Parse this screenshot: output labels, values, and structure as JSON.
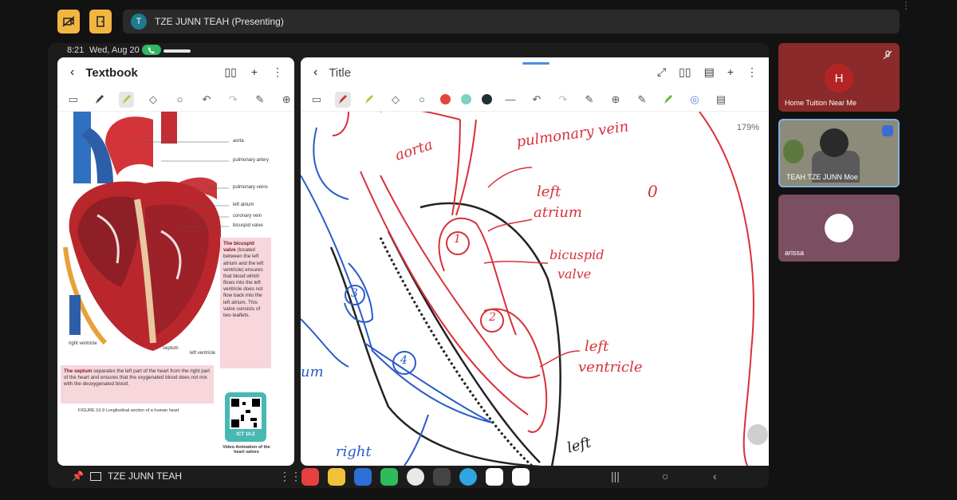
{
  "meeting": {
    "presenter_label": "TZE JUNN TEAH (Presenting)",
    "presenter_initial": "T",
    "bottom_presenter_name": "TZE JUNN TEAH"
  },
  "tablet": {
    "status_time": "8:21",
    "status_date": "Wed, Aug 20"
  },
  "left_panel": {
    "title": "Textbook",
    "heart_labels": [
      "aorta",
      "pulmonary artery",
      "pulmonary veins",
      "left atrium",
      "coronary vein",
      "bicuspid valve",
      "right ventricle",
      "septum",
      "left ventricle"
    ],
    "bicuspid_box": {
      "bold": "The bicuspid valve",
      "text": "(located between the left atrium and the left ventricle) ensures that blood which flows into the left ventricle does not flow back into the left atrium. This valve consists of two leaflets."
    },
    "septum_box": {
      "bold": "The septum",
      "text": "separates the left part of the heart from the right part of the heart and ensures that the oxygenated blood does not mix with the deoxygenated blood."
    },
    "figure_caption": "FIGURE 10.9 Longitudinal section of a human heart",
    "qr_label": "ICT 10.2",
    "qr_caption": "Video Animation of the heart valves"
  },
  "right_panel": {
    "title": "Title",
    "zoom": "179%",
    "pen_colors": [
      "#e0453e",
      "#7fd1c0",
      "#1f3036"
    ],
    "handwriting": {
      "aorta": "aorta",
      "pulmonary_vein": "pulmonary vein",
      "left_atrium_1": "left",
      "left_atrium_2": "atrium",
      "zero": "0",
      "bicuspid_1": "bicuspid",
      "bicuspid_2": "valve",
      "left_ventricle_1": "left",
      "left_ventricle_2": "ventricle",
      "circle_1": "1",
      "circle_2": "2",
      "circle_3": "3",
      "circle_4": "4",
      "right": "right",
      "left": "left",
      "um": "um"
    }
  },
  "participants": [
    {
      "initial": "H",
      "name": "Home Tuition Near Me",
      "color": "#b52424"
    },
    {
      "name": "TEAH TZE JUNN Moe"
    },
    {
      "name": "arissa"
    }
  ]
}
